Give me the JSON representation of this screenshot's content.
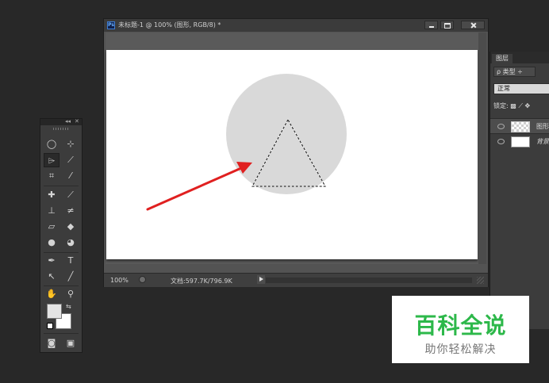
{
  "document": {
    "app_badge": "Ps",
    "title": "未标题-1 @ 100% (图形, RGB/8) *",
    "zoom": "100%",
    "doc_size": "文档:597.7K/796.9K"
  },
  "layers_panel": {
    "tab": "图层",
    "filter": "ρ 类型 ÷",
    "blend_mode": "正常",
    "lock_label": "锁定:",
    "layers": [
      {
        "name": "图形",
        "visible": true,
        "selected": true
      },
      {
        "name": "背景",
        "visible": true,
        "selected": false
      }
    ]
  },
  "toolbox": {
    "collapse": "◂◂",
    "close": "✕",
    "selected_tool": "polygonal-lasso"
  },
  "canvas_shapes": {
    "circle_color": "#d9d9d9",
    "triangle_style": "marching-ants selection"
  },
  "annotation_arrow_color": "#e02020",
  "watermark": {
    "title": "百科全说",
    "subtitle": "助你轻松解决",
    "title_color": "#2db84a"
  }
}
